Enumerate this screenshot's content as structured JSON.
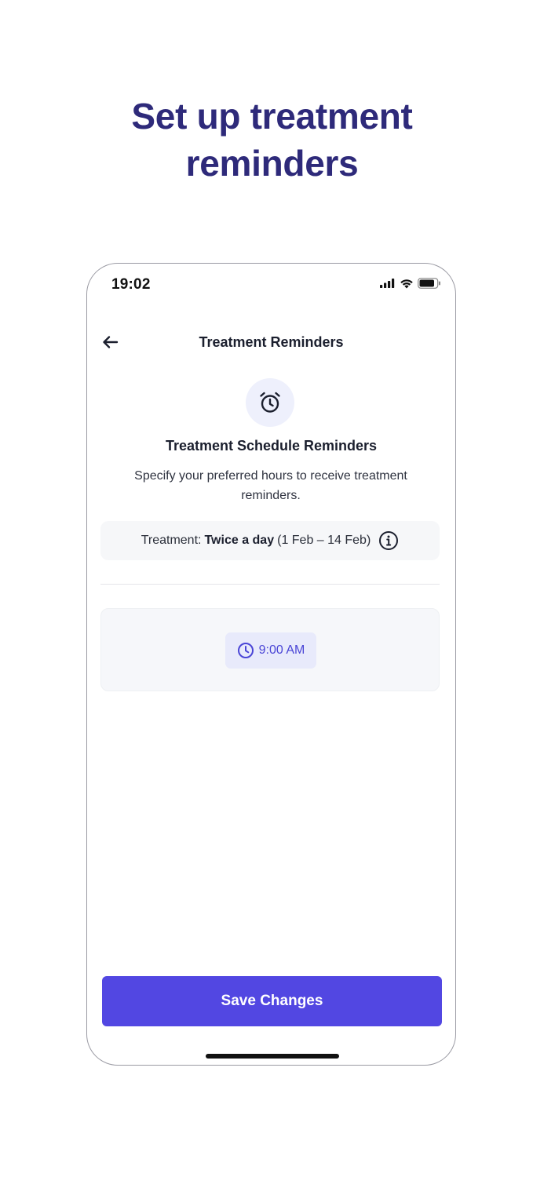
{
  "headline": {
    "line1": "Set up treatment",
    "line2": "reminders"
  },
  "status_bar": {
    "time": "19:02",
    "icons": [
      "signal-icon",
      "wifi-icon",
      "battery-icon"
    ]
  },
  "nav": {
    "back_icon": "arrow-left-icon",
    "title": "Treatment Reminders"
  },
  "hero": {
    "icon": "alarm-clock-icon",
    "title": "Treatment Schedule Reminders",
    "description": "Specify your preferred hours to receive treatment reminders."
  },
  "treatment": {
    "label": "Treatment:",
    "frequency": "Twice a day",
    "range": "(1 Feb – 14 Feb)",
    "info_icon": "info-icon"
  },
  "reminder_times": [
    {
      "icon": "clock-icon",
      "time": "9:00 AM"
    }
  ],
  "footer": {
    "save_label": "Save Changes"
  },
  "colors": {
    "headline": "#2e2a7a",
    "accent": "#5247e2",
    "chip_bg": "#e8eafb",
    "chip_text": "#4a45d6",
    "alarm_bg": "#eef0fc"
  }
}
